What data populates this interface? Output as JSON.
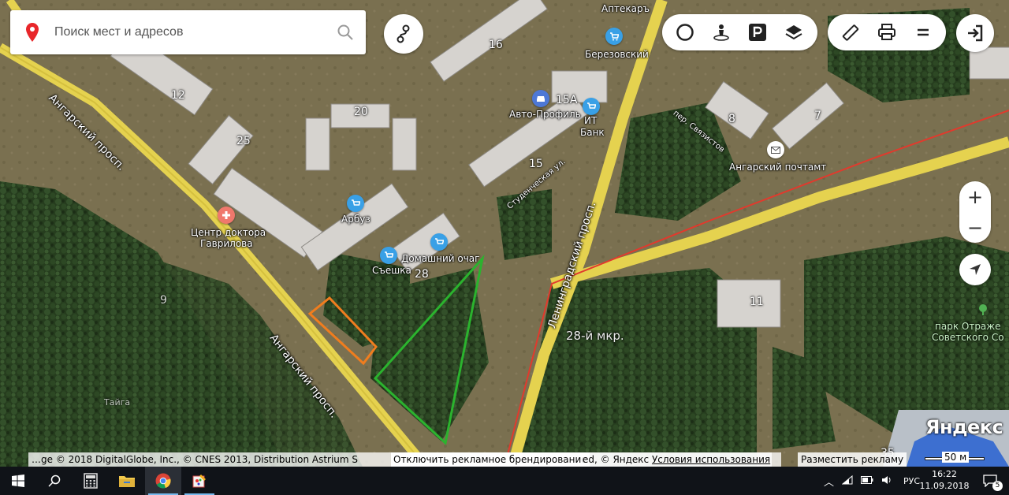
{
  "search": {
    "placeholder": "Поиск мест и адресов"
  },
  "map": {
    "buildings": [
      "12",
      "20",
      "25",
      "16",
      "15А",
      "15",
      "8",
      "7",
      "28",
      "11",
      "35"
    ],
    "pois": [
      {
        "name": "Аптекаръ",
        "icon": "pharmacy-icon"
      },
      {
        "name": "Березовский",
        "icon": "shop-icon"
      },
      {
        "name": "Авто-Профиль",
        "icon": "car-icon"
      },
      {
        "name": "ИТ",
        "icon": "shop-icon"
      },
      {
        "name": "Банк",
        "icon": "bank-icon"
      },
      {
        "name": "Ангарский почтамт",
        "icon": "mail-icon"
      },
      {
        "name": "Арбуз",
        "icon": "shop-icon"
      },
      {
        "name": "Центр доктора",
        "icon": "medical-icon"
      },
      {
        "name": "Гаврилова",
        "icon": "medical-icon"
      },
      {
        "name": "Съешка",
        "icon": "shop-icon"
      },
      {
        "name": "Домашний очаг",
        "icon": "shop-icon"
      }
    ],
    "streets": [
      "Ангарский просп.",
      "Ангарский просп.",
      "Ленинградский просп.",
      "пер. Связистов",
      "Студенческая ул."
    ],
    "district": "28-й мкр.",
    "park": [
      "парк Отраже",
      "Советского Со"
    ],
    "markers": [
      "9",
      "Тайга"
    ],
    "annotations": [
      {
        "shape": "rectangle",
        "color": "#f07d1e"
      },
      {
        "shape": "triangle",
        "color": "#2bb32e"
      }
    ]
  },
  "controls": {
    "layers": [
      "traffic-icon",
      "panorama-icon",
      "parking-icon",
      "layers-icon"
    ],
    "tools": [
      "ruler-icon",
      "print-icon",
      "menu-icon"
    ],
    "zoom_in": "+",
    "zoom_out": "−"
  },
  "footer": {
    "copyright": "…ge © 2018 DigitalGlobe, Inc., © CNES 2013, Distribution Astrium S",
    "ad_toggle": "Отключить рекламное брендирование",
    "copyright_tail": "ed, © Яндекс",
    "terms": "Условия использования",
    "place_ad": "Разместить рекламу",
    "scale": "50 м",
    "logo": "Яндекс"
  },
  "taskbar": {
    "apps": [
      "windows-start",
      "search",
      "calculator",
      "file-explorer",
      "chrome",
      "paint"
    ],
    "language": "РУС",
    "time": "16:22",
    "date": "11.09.2018",
    "notifications": "5"
  }
}
